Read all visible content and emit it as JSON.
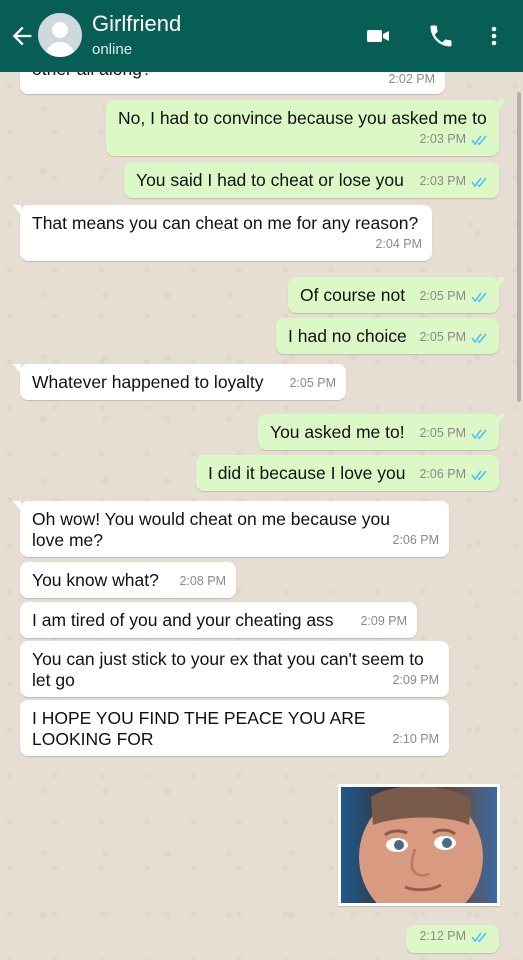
{
  "header": {
    "contact_name": "Girlfriend",
    "status": "online",
    "colors": {
      "bar": "#075e54",
      "sent_bubble": "#dcf8c6",
      "received_bubble": "#ffffff",
      "read_ticks": "#4fc3f7"
    }
  },
  "messages": [
    {
      "dir": "in",
      "text": "other all along?",
      "time": "2:02 PM"
    },
    {
      "dir": "out",
      "text": "No, I had to convince because you asked me to",
      "time": "2:03 PM",
      "read": true
    },
    {
      "dir": "out",
      "text": "You said I had to cheat or lose you",
      "time": "2:03 PM",
      "read": true
    },
    {
      "dir": "in",
      "text": "That means you can cheat on me for any reason?",
      "time": "2:04 PM"
    },
    {
      "dir": "out",
      "text": "Of course not",
      "time": "2:05 PM",
      "read": true
    },
    {
      "dir": "out",
      "text": "I had no choice",
      "time": "2:05 PM",
      "read": true
    },
    {
      "dir": "in",
      "text": "Whatever happened to loyalty",
      "time": "2:05 PM"
    },
    {
      "dir": "out",
      "text": "You asked me to!",
      "time": "2:05 PM",
      "read": true
    },
    {
      "dir": "out",
      "text": "I did it because I love you",
      "time": "2:06 PM",
      "read": true
    },
    {
      "dir": "in",
      "text": "Oh wow! You would cheat on me because you love me?",
      "time": "2:06 PM"
    },
    {
      "dir": "in",
      "text": "You know what?",
      "time": "2:08 PM"
    },
    {
      "dir": "in",
      "text": "I am tired of you and your cheating ass",
      "time": "2:09 PM"
    },
    {
      "dir": "in",
      "text": "You can just stick to your ex that you can't seem to let go",
      "time": "2:09 PM"
    },
    {
      "dir": "in",
      "text": "I HOPE YOU FIND THE PEACE YOU ARE LOOKING FOR",
      "time": "2:10 PM"
    },
    {
      "dir": "out",
      "text": "",
      "time": "2:12 PM",
      "read": true,
      "image": "reaction-face-photo"
    }
  ],
  "icons": {
    "back": "arrow-left-icon",
    "video": "video-call-icon",
    "call": "phone-icon",
    "menu": "more-vert-icon",
    "read": "double-check-icon"
  }
}
